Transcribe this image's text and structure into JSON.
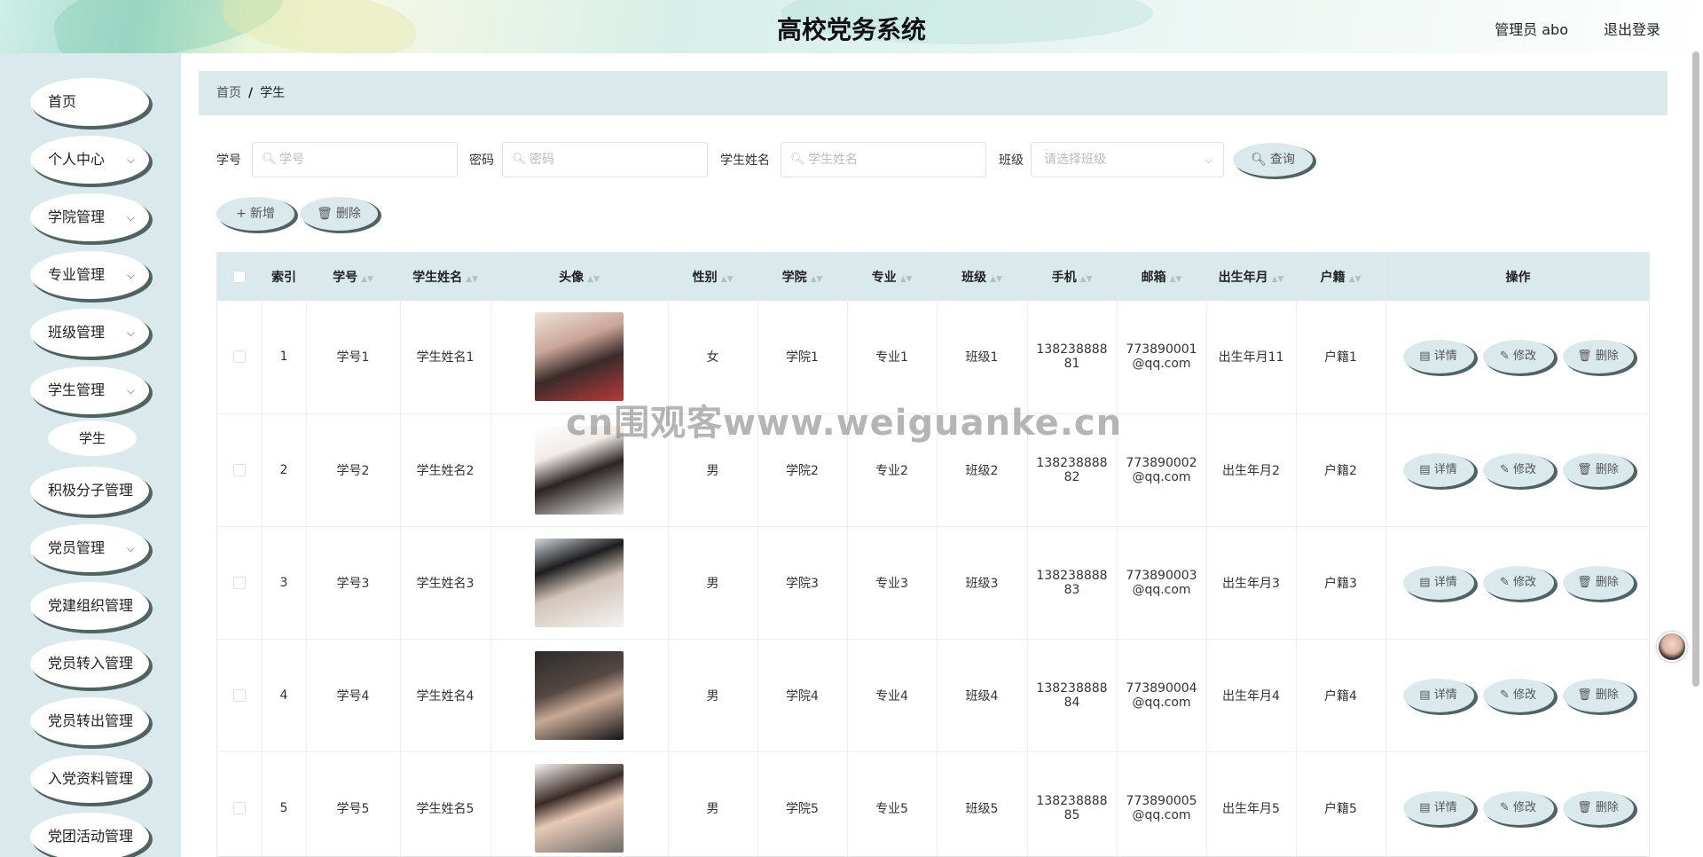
{
  "header": {
    "title": "高校党务系统",
    "user": "管理员 abo",
    "logout": "退出登录"
  },
  "sidebar": {
    "items": [
      {
        "label": "首页",
        "has_sub": false
      },
      {
        "label": "个人中心",
        "has_sub": true
      },
      {
        "label": "学院管理",
        "has_sub": true
      },
      {
        "label": "专业管理",
        "has_sub": true
      },
      {
        "label": "班级管理",
        "has_sub": true
      },
      {
        "label": "学生管理",
        "has_sub": true
      },
      {
        "label": "积极分子管理",
        "has_sub": true
      },
      {
        "label": "党员管理",
        "has_sub": true
      },
      {
        "label": "党建组织管理",
        "has_sub": false
      },
      {
        "label": "党员转入管理",
        "has_sub": false
      },
      {
        "label": "党员转出管理",
        "has_sub": false
      },
      {
        "label": "入党资料管理",
        "has_sub": false
      },
      {
        "label": "党团活动管理",
        "has_sub": false
      }
    ],
    "sub_item": "学生"
  },
  "breadcrumb": {
    "home": "首页",
    "sep": "/",
    "current": "学生"
  },
  "search": {
    "xuehao_label": "学号",
    "xuehao_placeholder": "学号",
    "mima_label": "密码",
    "mima_placeholder": "密码",
    "name_label": "学生姓名",
    "name_placeholder": "学生姓名",
    "class_label": "班级",
    "class_placeholder": "请选择班级",
    "query_button": "查询"
  },
  "actions": {
    "add": "新增",
    "delete": "删除"
  },
  "table": {
    "headers": [
      "索引",
      "学号",
      "学生姓名",
      "头像",
      "性别",
      "学院",
      "专业",
      "班级",
      "手机",
      "邮箱",
      "出生年月",
      "户籍",
      "操作"
    ],
    "ops": {
      "detail": "详情",
      "edit": "修改",
      "delete": "删除"
    },
    "rows": [
      {
        "index": "1",
        "xuehao": "学号1",
        "name": "学生姓名1",
        "gender": "女",
        "college": "学院1",
        "major": "专业1",
        "class": "班级1",
        "phone_a": "138238888",
        "phone_b": "81",
        "email_a": "773890001",
        "email_b": "@qq.com",
        "birth": "出生年月11",
        "huji": "户籍1"
      },
      {
        "index": "2",
        "xuehao": "学号2",
        "name": "学生姓名2",
        "gender": "男",
        "college": "学院2",
        "major": "专业2",
        "class": "班级2",
        "phone_a": "138238888",
        "phone_b": "82",
        "email_a": "773890002",
        "email_b": "@qq.com",
        "birth": "出生年月2",
        "huji": "户籍2"
      },
      {
        "index": "3",
        "xuehao": "学号3",
        "name": "学生姓名3",
        "gender": "男",
        "college": "学院3",
        "major": "专业3",
        "class": "班级3",
        "phone_a": "138238888",
        "phone_b": "83",
        "email_a": "773890003",
        "email_b": "@qq.com",
        "birth": "出生年月3",
        "huji": "户籍3"
      },
      {
        "index": "4",
        "xuehao": "学号4",
        "name": "学生姓名4",
        "gender": "男",
        "college": "学院4",
        "major": "专业4",
        "class": "班级4",
        "phone_a": "138238888",
        "phone_b": "84",
        "email_a": "773890004",
        "email_b": "@qq.com",
        "birth": "出生年月4",
        "huji": "户籍4"
      },
      {
        "index": "5",
        "xuehao": "学号5",
        "name": "学生姓名5",
        "gender": "男",
        "college": "学院5",
        "major": "专业5",
        "class": "班级5",
        "phone_a": "138238888",
        "phone_b": "85",
        "email_a": "773890005",
        "email_b": "@qq.com",
        "birth": "出生年月5",
        "huji": "户籍5"
      }
    ]
  },
  "watermark": "cn围观客www.weiguanke.cn",
  "colors": {
    "accent": "#d9e9ec",
    "pill_shadow": "#4f6362"
  }
}
